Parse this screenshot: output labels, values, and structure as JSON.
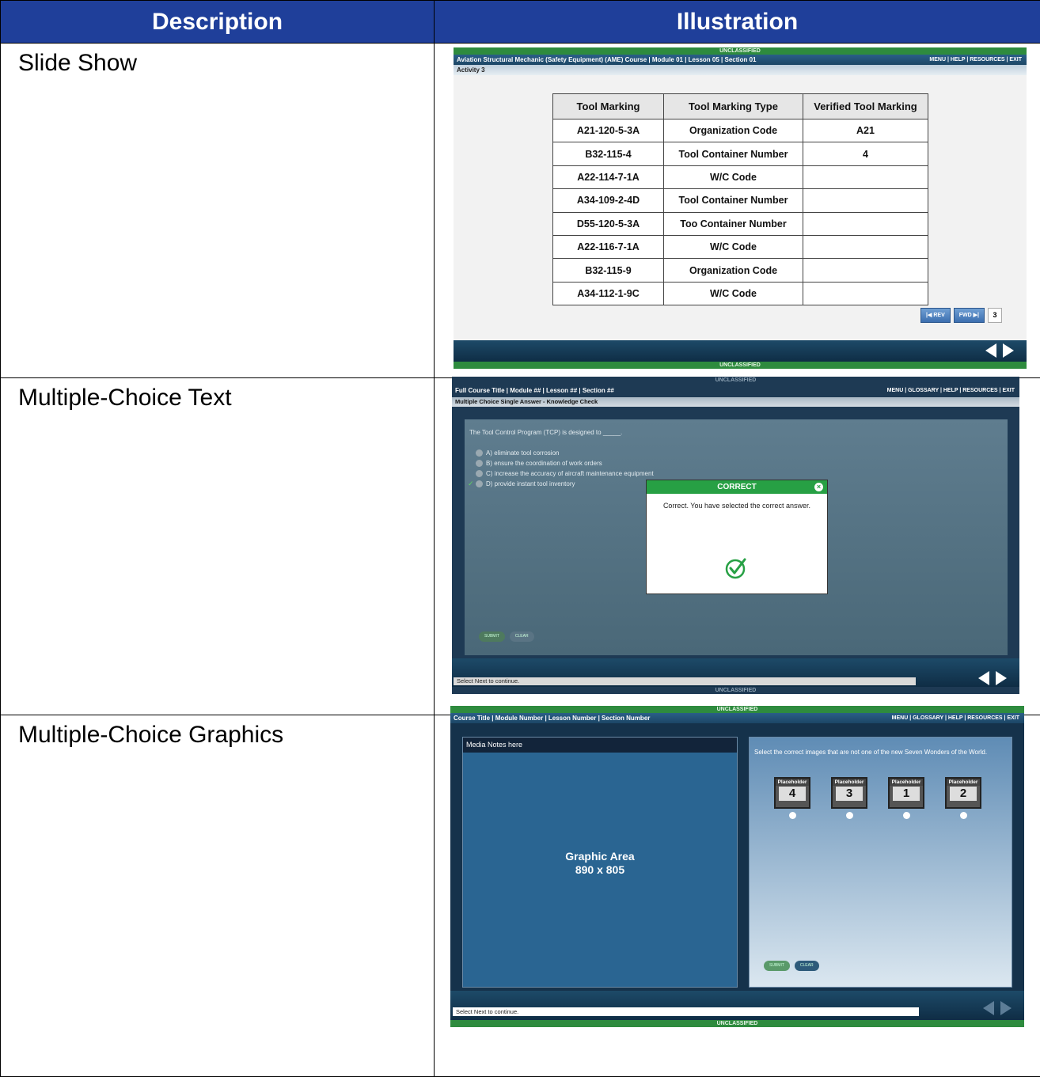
{
  "headers": {
    "description": "Description",
    "illustration": "Illustration"
  },
  "rows": [
    {
      "description": "Slide Show"
    },
    {
      "description": "Multiple-Choice Text"
    },
    {
      "description": "Multiple-Choice Graphics"
    }
  ],
  "shot1": {
    "classification_top": "UNCLASSIFIED",
    "title": "Aviation Structural Mechanic (Safety Equipment) (AME) Course | Module 01 | Lesson 05 | Section 01",
    "nav": "MENU | HELP | RESOURCES | EXIT",
    "subtitle": "Activity 3",
    "table_headers": [
      "Tool Marking",
      "Tool Marking Type",
      "Verified Tool Marking"
    ],
    "table_rows": [
      [
        "A21-120-5-3A",
        "Organization Code",
        "A21"
      ],
      [
        "B32-115-4",
        "Tool Container Number",
        "4"
      ],
      [
        "A22-114-7-1A",
        "W/C Code",
        ""
      ],
      [
        "A34-109-2-4D",
        "Tool Container Number",
        ""
      ],
      [
        "D55-120-5-3A",
        "Too Container Number",
        ""
      ],
      [
        "A22-116-7-1A",
        "W/C Code",
        ""
      ],
      [
        "B32-115-9",
        "Organization Code",
        ""
      ],
      [
        "A34-112-1-9C",
        "W/C Code",
        ""
      ]
    ],
    "rev_label": "REV",
    "fwd_label": "FWD",
    "page_number": "3",
    "classification_bottom": "UNCLASSIFIED"
  },
  "shot2": {
    "classification_top": "UNCLASSIFIED",
    "title": "Full Course Title | Module ## | Lesson ## | Section ##",
    "nav": "MENU | GLOSSARY | HELP | RESOURCES | EXIT",
    "subtitle": "Multiple Choice Single Answer - Knowledge Check",
    "question": "The Tool Control Program (TCP) is designed to _____.",
    "options": [
      "A) eliminate tool corrosion",
      "B) ensure the coordination of work orders",
      "C) increase the accuracy of aircraft maintenance equipment",
      "D) provide instant tool inventory"
    ],
    "submit_label": "SUBMIT",
    "clear_label": "CLEAR",
    "dialog_title": "CORRECT",
    "dialog_text": "Correct. You have selected the correct answer.",
    "status_text": "Select Next to continue.",
    "classification_bottom": "UNCLASSIFIED"
  },
  "shot3": {
    "classification_top": "UNCLASSIFIED",
    "title": "Course Title | Module Number | Lesson Number | Section Number",
    "nav": "MENU | GLOSSARY | HELP | RESOURCES | EXIT",
    "media_notes": "Media Notes here",
    "graphic_area_line1": "Graphic Area",
    "graphic_area_line2": "890 x 805",
    "instruction": "Select the correct images that are not one of the new Seven Wonders of the World.",
    "placeholder_label": "Placeholder",
    "placeholders": [
      "4",
      "3",
      "1",
      "2"
    ],
    "submit_label": "SUBMIT",
    "clear_label": "CLEAR",
    "status_text": "Select Next to continue.",
    "classification_bottom": "UNCLASSIFIED"
  }
}
